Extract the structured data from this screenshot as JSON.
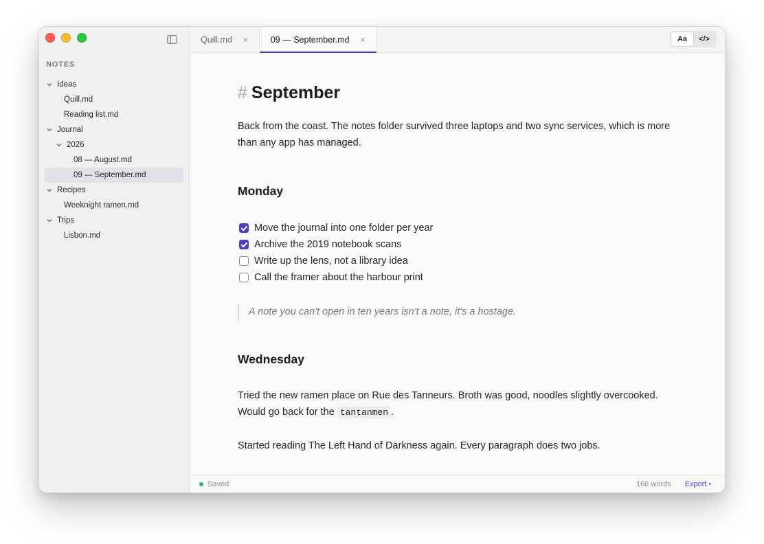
{
  "sidebar": {
    "heading": "NOTES",
    "items": [
      {
        "label": "Ideas",
        "folder": true,
        "expanded": true
      },
      {
        "label": "Quill.md"
      },
      {
        "label": "Reading list.md"
      },
      {
        "label": "Journal",
        "folder": true,
        "expanded": true
      },
      {
        "label": "2026",
        "folder": true,
        "expanded": true
      },
      {
        "label": "08 — August.md"
      },
      {
        "label": "09 — September.md",
        "selected": true
      },
      {
        "label": "Recipes",
        "folder": true,
        "expanded": true
      },
      {
        "label": "Weeknight ramen.md"
      },
      {
        "label": "Trips",
        "folder": true,
        "expanded": true
      },
      {
        "label": "Lisbon.md"
      }
    ]
  },
  "tabs": [
    {
      "label": "Quill.md",
      "close": "×",
      "active": false
    },
    {
      "label": "09 — September.md",
      "close": "×",
      "active": true
    }
  ],
  "mode_switch": {
    "preview": "Aa",
    "source": "</>"
  },
  "editor": {
    "h1_hash": "#",
    "title": "September",
    "intro": "Back from the coast. The notes folder survived three laptops and two sync services, which is more than any app has managed.",
    "monday_heading": "Monday",
    "tasks": [
      {
        "text": "Move the journal into one folder per year",
        "checked": true
      },
      {
        "text": "Archive the 2019 notebook scans",
        "checked": true
      },
      {
        "text": "Write up the lens, not a library idea",
        "checked": false
      },
      {
        "text": "Call the framer about the harbour print",
        "checked": false
      }
    ],
    "quote": "A note you can't open in ten years isn't a note, it's a hostage.",
    "wednesday_heading": "Wednesday",
    "ramen_before": "Tried the new ramen place on Rue des Tanneurs. Broth was good, noodles slightly overcooked. Would go back for the ",
    "ramen_code": "tantanmen",
    "ramen_after": ".",
    "reading": "Started reading The Left Hand of Darkness again. Every paragraph does two jobs."
  },
  "status": {
    "saved": "Saved",
    "saved_color": "#2fb46c",
    "words": "166 words",
    "export": "Export",
    "export_caret": "▾"
  },
  "colors": {
    "accent": "#4b3fc9"
  }
}
